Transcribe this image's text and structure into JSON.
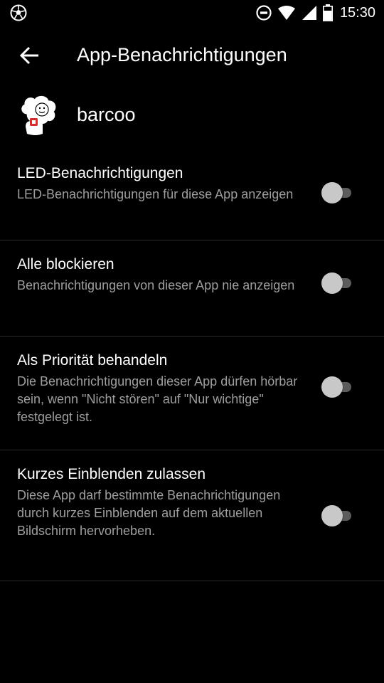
{
  "status_bar": {
    "time": "15:30",
    "icons": [
      "soccer-ball-icon",
      "do-not-disturb-icon",
      "wifi-icon",
      "signal-icon",
      "battery-icon"
    ]
  },
  "toolbar": {
    "title": "App-Benachrichtigungen",
    "back_icon": "arrow-back-icon"
  },
  "app": {
    "name": "barcoo",
    "icon": "barcoo-app-icon"
  },
  "settings": [
    {
      "title": "LED-Benachrichtigungen",
      "summary": "LED-Benachrichtigungen für diese App anzeigen",
      "enabled": false
    },
    {
      "title": "Alle blockieren",
      "summary": "Benachrichtigungen von dieser App nie anzeigen",
      "enabled": false
    },
    {
      "title": "Als Priorität behandeln",
      "summary": "Die Benachrichtigungen dieser App dürfen hörbar sein, wenn \"Nicht stören\" auf \"Nur wichtige\" festgelegt ist.",
      "enabled": false
    },
    {
      "title": "Kurzes Einblenden zulassen",
      "summary": "Diese App darf bestimmte Benachrichtigungen durch kurzes Einblenden auf dem aktuellen Bildschirm hervorheben.",
      "enabled": false
    }
  ],
  "colors": {
    "background": "#000000",
    "primary_text": "#ffffff",
    "secondary_text": "#9e9e9e",
    "toggle_off_thumb": "#c8c8c8",
    "toggle_off_track": "#5c5c5c",
    "app_icon_accent": "#d32f2f"
  }
}
